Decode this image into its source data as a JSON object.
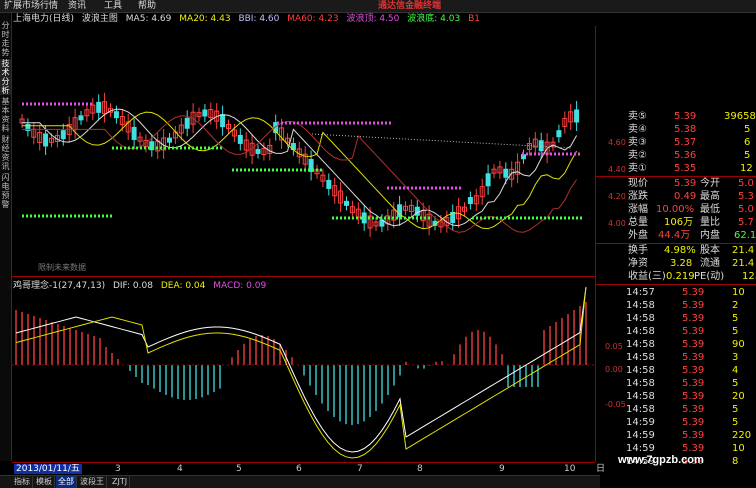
{
  "menu": {
    "items": [
      "扩展市场行情",
      "资讯",
      "工具",
      "帮助"
    ],
    "brand": "通达信金融终端"
  },
  "left_tabs": [
    "分时走势",
    "技术分析",
    "基本资料",
    "财经资讯",
    "闪电预警"
  ],
  "main_header": {
    "stock": "上海电力(日线)",
    "template": "波浪主图",
    "ma5": "MA5: 4.69",
    "ma20": "MA20: 4.43",
    "bbi": "BBI: 4.60",
    "ma60": "MA60: 4.23",
    "wave_top": "波浪顶: 4.50",
    "wave_bottom": "波浪底: 4.03",
    "extra": "B1"
  },
  "hint_text": "限制未来数据",
  "price_axis": [
    "4.60",
    "4.40",
    "4.20",
    "4.00"
  ],
  "macd_header": {
    "name": "鸡哥理念-1(27,47,13)",
    "dif": "DIF: 0.08",
    "dea": "DEA: 0.04",
    "macd": "MACD: 0.09"
  },
  "macd_axis": [
    "0.05",
    "0.00",
    "-0.05"
  ],
  "x_axis": {
    "date": "2013/01/11/五",
    "ticks": [
      "3",
      "4",
      "5",
      "6",
      "7",
      "8",
      "9",
      "10"
    ],
    "right": "日"
  },
  "bottom_tabs": [
    "指标",
    "模板",
    "全部",
    "波段王",
    "ZJTJ"
  ],
  "quote": {
    "asks": [
      {
        "label": "卖⑤",
        "price": "5.39",
        "vol": "39658"
      },
      {
        "label": "卖④",
        "price": "5.38",
        "vol": "5"
      },
      {
        "label": "卖③",
        "price": "5.37",
        "vol": "6"
      },
      {
        "label": "卖②",
        "price": "5.36",
        "vol": "5"
      },
      {
        "label": "卖①",
        "price": "5.35",
        "vol": "12"
      }
    ],
    "stats": [
      {
        "l1": "现价",
        "v1": "5.39",
        "l2": "今开",
        "v2": "5.0"
      },
      {
        "l1": "涨跌",
        "v1": "0.49",
        "l2": "最高",
        "v2": "5.3"
      },
      {
        "l1": "涨幅",
        "v1": "10.00%",
        "l2": "最低",
        "v2": "5.0"
      },
      {
        "l1": "总量",
        "v1": "106万",
        "l2": "量比",
        "v2": "5.7"
      },
      {
        "l1": "外盘",
        "v1": "44.4万",
        "l2": "内盘",
        "v2": "62.1"
      }
    ],
    "stats2": [
      {
        "l1": "换手",
        "v1": "4.98%",
        "l2": "股本",
        "v2": "21.4"
      },
      {
        "l1": "净资",
        "v1": "3.28",
        "l2": "流通",
        "v2": "21.4"
      },
      {
        "l1": "收益(三)",
        "v1": "0.219",
        "l2": "PE(动)",
        "v2": "12."
      }
    ],
    "ticks": [
      {
        "t": "14:57",
        "p": "5.39",
        "v": "10"
      },
      {
        "t": "14:58",
        "p": "5.39",
        "v": "2"
      },
      {
        "t": "14:58",
        "p": "5.39",
        "v": "5"
      },
      {
        "t": "14:58",
        "p": "5.39",
        "v": "5"
      },
      {
        "t": "14:58",
        "p": "5.39",
        "v": "90"
      },
      {
        "t": "14:58",
        "p": "5.39",
        "v": "3"
      },
      {
        "t": "14:58",
        "p": "5.39",
        "v": "4"
      },
      {
        "t": "14:58",
        "p": "5.39",
        "v": "5"
      },
      {
        "t": "14:58",
        "p": "5.39",
        "v": "20"
      },
      {
        "t": "14:58",
        "p": "5.39",
        "v": "5"
      },
      {
        "t": "14:59",
        "p": "5.39",
        "v": "5"
      },
      {
        "t": "14:59",
        "p": "5.39",
        "v": "220"
      },
      {
        "t": "14:59",
        "p": "5.39",
        "v": "10"
      },
      {
        "t": "14:59",
        "p": "5.39",
        "v": "8"
      }
    ]
  },
  "watermark": "www.7gpzb.com",
  "colors": {
    "up": "#ff4040",
    "down": "#40e0e0",
    "wave": "#e050e0",
    "support": "#40ff40"
  }
}
